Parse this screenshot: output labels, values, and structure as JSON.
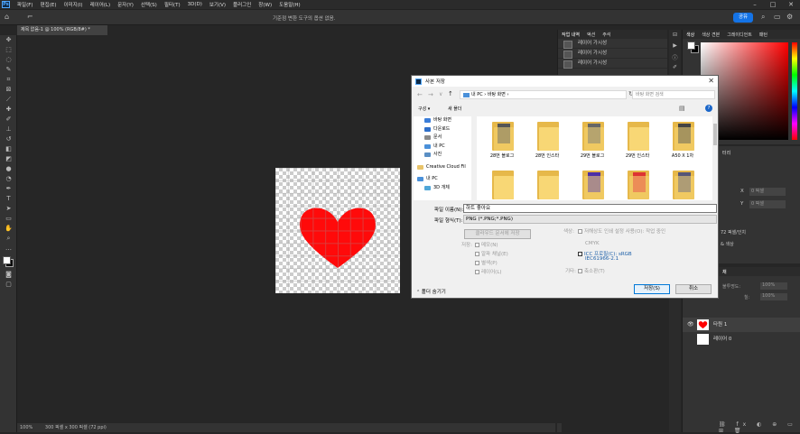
{
  "menubar": {
    "logo": "Ps",
    "items": [
      "파일(F)",
      "편집(E)",
      "이미지(I)",
      "레이어(L)",
      "문자(Y)",
      "선택(S)",
      "필터(T)",
      "3D(D)",
      "보기(V)",
      "플러그인",
      "창(W)",
      "도움말(H)"
    ]
  },
  "optionsbar": {
    "message": "기준점 변환 도구의 옵션 없음.",
    "share_label": "공유"
  },
  "document": {
    "tab_title": "제목 없음-1 @ 100% (RGB/8#) *",
    "zoom": "100%",
    "doc_info": "300 픽셀 x 300 픽셀 (72 ppi)"
  },
  "history_panel": {
    "tabs": [
      "작업 내역",
      "액션",
      "주석"
    ],
    "items": [
      "레이어 가시성",
      "레이어 가시성",
      "레이어 가시성"
    ]
  },
  "color_panel": {
    "tabs": [
      "색상",
      "색상 견본",
      "그레이디언트",
      "패턴"
    ]
  },
  "properties_panel": {
    "label_x": "X",
    "label_y": "Y",
    "x_value": "0 픽셀",
    "y_value": "0 픽셀",
    "partial1": "터리",
    "partial2": "72 픽셀/인치",
    "partial3": "& 색상"
  },
  "layers_panel": {
    "tab": "채",
    "opacity_label": "불투명도:",
    "opacity_value": "100%",
    "fill_label": "칠:",
    "fill_value": "100%",
    "layers": [
      {
        "name": "타원 1"
      },
      {
        "name": "레이어 0"
      }
    ]
  },
  "dialog": {
    "title": "사본 저장",
    "address": "내 PC  ›  바탕 화면  ›",
    "search_placeholder": "바탕 화면 검색",
    "organize": "구성 ▾",
    "new_folder": "새 폴더",
    "nav": [
      {
        "label": "바탕 화면",
        "color": "#3b7dd8"
      },
      {
        "label": "다운로드",
        "color": "#2f6fc9"
      },
      {
        "label": "문서",
        "color": "#8a8a8a"
      },
      {
        "label": "내 PC",
        "color": "#4a90d9"
      },
      {
        "label": "사진",
        "color": "#5a8fc4"
      },
      {
        "label": "Creative Cloud Fil",
        "color": "#e8c36a"
      },
      {
        "label": "내 PC",
        "color": "#4a90d9"
      },
      {
        "label": "3D 개체",
        "color": "#4fa6d8"
      }
    ],
    "files": [
      {
        "label": "28번 블로그",
        "pic": "#555"
      },
      {
        "label": "28번 인스타",
        "pic": ""
      },
      {
        "label": "29번 블로그",
        "pic": "#666"
      },
      {
        "label": "29번 인스타",
        "pic": ""
      },
      {
        "label": "A50 X 1차",
        "pic": "#444"
      },
      {
        "label": "",
        "pic": ""
      },
      {
        "label": "",
        "pic": ""
      },
      {
        "label": "",
        "pic": "#4b2fa6"
      },
      {
        "label": "",
        "pic": "#d33"
      },
      {
        "label": "",
        "pic": "#557"
      }
    ],
    "filename_label": "파일 이름(N):",
    "filename_value": "하트 좋아요",
    "filetype_label": "파일 형식(T):",
    "filetype_value": "PNG (*.PNG;*.PNG)",
    "cloud_btn": "클라우드 문서에 저장",
    "save_label": "저장:",
    "opt_memo": "메모(N)",
    "opt_alpha": "알파 채널(E)",
    "opt_spot": "별색(P)",
    "opt_layers": "레이어(L)",
    "color_label": "색상:",
    "opt_proof": "저해상도 인쇄 설정 사용(O):  작업 중인",
    "opt_cmyk": "CMYK",
    "opt_icc": "ICC 프로필(C):  sRGB",
    "icc_value": "IEC61966-2.1",
    "other_label": "기타:",
    "opt_thumb": "축소판(T)",
    "hide_folders": "폴더 숨기기",
    "save_btn": "저장(S)",
    "cancel_btn": "취소"
  }
}
